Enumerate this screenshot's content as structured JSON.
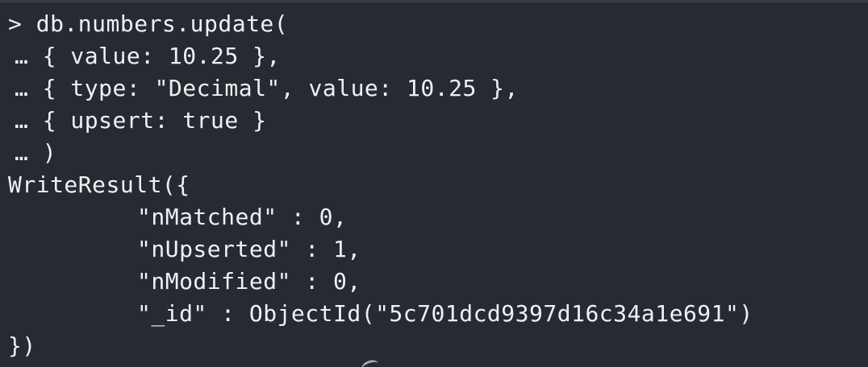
{
  "lines": [
    "> db.numbers.update(",
    "… { value: 10.25 },",
    "… { type: \"Decimal\", value: 10.25 },",
    "… { upsert: true }",
    "… )",
    "WriteResult({",
    "\"nMatched\" : 0,",
    "\"nUpserted\" : 1,",
    "\"nModified\" : 0,",
    "\"_id\" : ObjectId(\"5c701dcd9397d16c34a1e691\")",
    "})"
  ],
  "colors": {
    "background": "#282a32",
    "text": "#eef0f4"
  }
}
